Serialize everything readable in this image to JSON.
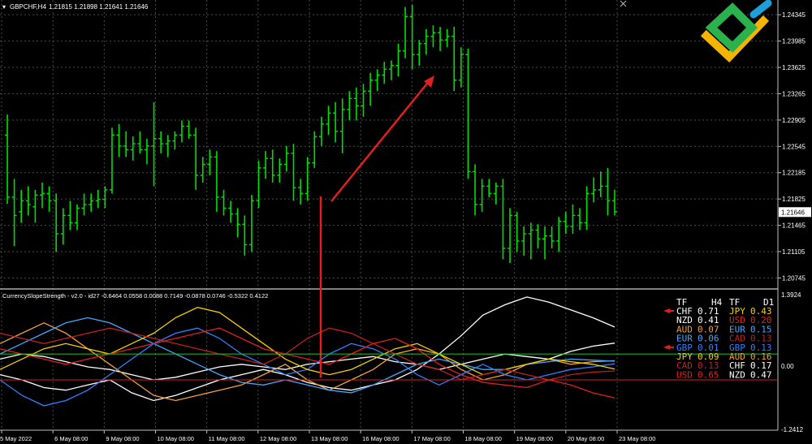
{
  "window": {
    "symbol_label": "GBPCHF,H4",
    "ohlc": "1.21815 1.21898 1.21641 1.21646",
    "close_icon": "close-x-icon"
  },
  "logo": {
    "icon": "litefinance-logo-icon",
    "colors": [
      "#2bb24c",
      "#1e9fd8",
      "#f5b400"
    ]
  },
  "colors": {
    "background": "#000000",
    "grid": "#4a4a4a",
    "candle": "#00e000",
    "arrow": "#e0201c",
    "hline_green": "#20c020",
    "hline_red": "#d02020",
    "price_tag_bg": "#ffffff"
  },
  "price_axis": {
    "ticks": [
      "1.24345",
      "1.23985",
      "1.23625",
      "1.23265",
      "1.22905",
      "1.22545",
      "1.22185",
      "1.21825",
      "1.21465",
      "1.21105",
      "1.20745"
    ],
    "current": "1.21646"
  },
  "indicator": {
    "label": "CurrencySlopeStrength - v2.0 - id27 -0.6464 0.0558 0.0088 0.7149 -0.0878 0.0746 -0.5322 0.4122",
    "axis_ticks": [
      "1.3924",
      "0.00",
      "-1.2412"
    ],
    "table": {
      "headers": [
        "TF",
        "H4",
        "TF",
        "D1"
      ],
      "rows": [
        {
          "left": "CHF",
          "lval": "0.71",
          "right": "JPY",
          "rval": "0.43",
          "lcolor": "#ffffff",
          "rcolor": "#f5d000",
          "arrow": true
        },
        {
          "left": "NZD",
          "lval": "0.41",
          "right": "USD",
          "rval": "0.20",
          "lcolor": "#ffffff",
          "rcolor": "#e02020",
          "arrow": false
        },
        {
          "left": "AUD",
          "lval": "0.07",
          "right": "EUR",
          "rval": "0.15",
          "lcolor": "#f0a040",
          "rcolor": "#40a8ff",
          "arrow": false
        },
        {
          "left": "EUR",
          "lval": "0.06",
          "right": "CAD",
          "rval": "0.13",
          "lcolor": "#40a8ff",
          "rcolor": "#c02020",
          "arrow": false
        },
        {
          "left": "GBP",
          "lval": "0.01",
          "right": "GBP",
          "rval": "0.13",
          "lcolor": "#3080ff",
          "rcolor": "#3080ff",
          "arrow": true
        },
        {
          "left": "JPY",
          "lval": "0.09",
          "right": "AUD",
          "rval": "0.16",
          "lcolor": "#f5d000",
          "rcolor": "#f0a040",
          "arrow": false
        },
        {
          "left": "CAD",
          "lval": "0.13",
          "right": "CHF",
          "rval": "0.17",
          "lcolor": "#c02020",
          "rcolor": "#ffffff",
          "arrow": false
        },
        {
          "left": "USD",
          "lval": "0.65",
          "right": "NZD",
          "rval": "0.47",
          "lcolor": "#e02020",
          "rcolor": "#ffffff",
          "arrow": false
        }
      ]
    }
  },
  "time_axis": [
    "5 May 2022",
    "6 May 08:00",
    "9 May 08:00",
    "10 May 08:00",
    "11 May 08:00",
    "12 May 08:00",
    "13 May 08:00",
    "16 May 08:00",
    "17 May 08:00",
    "18 May 08:00",
    "19 May 08:00",
    "20 May 08:00",
    "23 May 08:00"
  ],
  "chart_data": [
    {
      "type": "ohlc",
      "title": "GBPCHF,H4",
      "ylim": [
        1.2065,
        1.2448
      ],
      "bars": [
        [
          1.227,
          1.2298,
          1.2176,
          1.2185
        ],
        [
          1.2185,
          1.221,
          1.2118,
          1.216
        ],
        [
          1.2165,
          1.2195,
          1.215,
          1.218
        ],
        [
          1.218,
          1.22,
          1.216,
          1.2175
        ],
        [
          1.2172,
          1.2195,
          1.215,
          1.2188
        ],
        [
          1.2188,
          1.2205,
          1.217,
          1.219
        ],
        [
          1.219,
          1.22,
          1.2165,
          1.218
        ],
        [
          1.218,
          1.219,
          1.211,
          1.2135
        ],
        [
          1.2135,
          1.217,
          1.212,
          1.216
        ],
        [
          1.216,
          1.218,
          1.214,
          1.215
        ],
        [
          1.215,
          1.2175,
          1.214,
          1.217
        ],
        [
          1.217,
          1.219,
          1.216,
          1.2175
        ],
        [
          1.2175,
          1.219,
          1.2165,
          1.218
        ],
        [
          1.218,
          1.2195,
          1.217,
          1.2182
        ],
        [
          1.2182,
          1.22,
          1.217,
          1.2195
        ],
        [
          1.2195,
          1.228,
          1.219,
          1.227
        ],
        [
          1.227,
          1.2285,
          1.224,
          1.2255
        ],
        [
          1.2255,
          1.2275,
          1.224,
          1.225
        ],
        [
          1.225,
          1.2268,
          1.2235,
          1.2258
        ],
        [
          1.2258,
          1.2275,
          1.2245,
          1.225
        ],
        [
          1.225,
          1.2265,
          1.223,
          1.2255
        ],
        [
          1.2255,
          1.2315,
          1.22,
          1.2265
        ],
        [
          1.2265,
          1.2275,
          1.2245,
          1.2258
        ],
        [
          1.2258,
          1.227,
          1.224,
          1.2262
        ],
        [
          1.2262,
          1.2275,
          1.225,
          1.227
        ],
        [
          1.227,
          1.229,
          1.226,
          1.2282
        ],
        [
          1.2282,
          1.229,
          1.2265,
          1.227
        ],
        [
          1.227,
          1.228,
          1.2195,
          1.2215
        ],
        [
          1.2215,
          1.224,
          1.2205,
          1.223
        ],
        [
          1.223,
          1.225,
          1.2215,
          1.224
        ],
        [
          1.224,
          1.2248,
          1.2165,
          1.2185
        ],
        [
          1.2185,
          1.2195,
          1.216,
          1.217
        ],
        [
          1.217,
          1.218,
          1.215,
          1.2162
        ],
        [
          1.2162,
          1.217,
          1.213,
          1.2148
        ],
        [
          1.2148,
          1.216,
          1.2105,
          1.212
        ],
        [
          1.212,
          1.2188,
          1.211,
          1.218
        ],
        [
          1.218,
          1.2235,
          1.217,
          1.2225
        ],
        [
          1.2225,
          1.2248,
          1.221,
          1.2238
        ],
        [
          1.2238,
          1.225,
          1.2205,
          1.2215
        ],
        [
          1.2215,
          1.2238,
          1.2205,
          1.223
        ],
        [
          1.223,
          1.2255,
          1.222,
          1.2245
        ],
        [
          1.2245,
          1.2258,
          1.218,
          1.2198
        ],
        [
          1.2198,
          1.221,
          1.2175,
          1.219
        ],
        [
          1.219,
          1.224,
          1.218,
          1.2232
        ],
        [
          1.2232,
          1.2275,
          1.2225,
          1.2268
        ],
        [
          1.2268,
          1.2295,
          1.2255,
          1.2285
        ],
        [
          1.2285,
          1.231,
          1.227,
          1.23
        ],
        [
          1.23,
          1.2315,
          1.226,
          1.2275
        ],
        [
          1.2275,
          1.232,
          1.2245,
          1.2305
        ],
        [
          1.2305,
          1.233,
          1.229,
          1.232
        ],
        [
          1.232,
          1.2335,
          1.229,
          1.231
        ],
        [
          1.231,
          1.234,
          1.2295,
          1.233
        ],
        [
          1.233,
          1.2355,
          1.231,
          1.2345
        ],
        [
          1.2345,
          1.236,
          1.233,
          1.2352
        ],
        [
          1.2352,
          1.237,
          1.234,
          1.236
        ],
        [
          1.236,
          1.2372,
          1.2345,
          1.2365
        ],
        [
          1.2365,
          1.2395,
          1.235,
          1.2385
        ],
        [
          1.2385,
          1.2445,
          1.2375,
          1.2432
        ],
        [
          1.2432,
          1.2448,
          1.236,
          1.238
        ],
        [
          1.238,
          1.24,
          1.2365,
          1.2395
        ],
        [
          1.2395,
          1.2415,
          1.238,
          1.2405
        ],
        [
          1.2405,
          1.242,
          1.239,
          1.241
        ],
        [
          1.241,
          1.2418,
          1.2385,
          1.24
        ],
        [
          1.24,
          1.2415,
          1.239,
          1.2405
        ],
        [
          1.2405,
          1.2418,
          1.233,
          1.2345
        ],
        [
          1.2345,
          1.239,
          1.2335,
          1.238
        ],
        [
          1.238,
          1.2388,
          1.221,
          1.222
        ],
        [
          1.222,
          1.223,
          1.216,
          1.2175
        ],
        [
          1.2175,
          1.221,
          1.2165,
          1.22
        ],
        [
          1.22,
          1.221,
          1.2185,
          1.219
        ],
        [
          1.219,
          1.2205,
          1.2175,
          1.22
        ],
        [
          1.22,
          1.221,
          1.21,
          1.2115
        ],
        [
          1.2115,
          1.217,
          1.2095,
          1.216
        ],
        [
          1.216,
          1.2165,
          1.211,
          1.2125
        ],
        [
          1.2125,
          1.2145,
          1.2105,
          1.2135
        ],
        [
          1.2135,
          1.215,
          1.21,
          1.214
        ],
        [
          1.214,
          1.2148,
          1.2115,
          1.2128
        ],
        [
          1.2128,
          1.2145,
          1.21,
          1.2132
        ],
        [
          1.2132,
          1.2145,
          1.2115,
          1.2125
        ],
        [
          1.2125,
          1.2158,
          1.211,
          1.2152
        ],
        [
          1.2152,
          1.2165,
          1.2135,
          1.2145
        ],
        [
          1.2145,
          1.2175,
          1.2135,
          1.216
        ],
        [
          1.216,
          1.217,
          1.214,
          1.215
        ],
        [
          1.215,
          1.22,
          1.214,
          1.219
        ],
        [
          1.219,
          1.2212,
          1.2178,
          1.2195
        ],
        [
          1.2195,
          1.222,
          1.2185,
          1.22
        ],
        [
          1.22,
          1.2225,
          1.216,
          1.218
        ],
        [
          1.218,
          1.2195,
          1.216,
          1.2165
        ]
      ],
      "annotations": [
        "arrow-up-right"
      ]
    },
    {
      "type": "line",
      "title": "CurrencySlopeStrength - v2.0",
      "ylim": [
        -1.2412,
        1.3924
      ],
      "hlines": [
        0.2,
        0.0
      ],
      "series": [
        {
          "name": "CHF",
          "color": "#ffffff",
          "values": [
            -0.2,
            -0.3,
            -0.45,
            -0.5,
            -0.4,
            -0.3,
            -0.55,
            -0.7,
            -0.6,
            -0.45,
            -0.3,
            -0.2,
            -0.1,
            -0.2,
            -0.35,
            -0.45,
            -0.5,
            -0.4,
            -0.3,
            -0.1,
            0.2,
            0.55,
            0.95,
            1.15,
            1.3,
            1.2,
            1.05,
            0.9,
            0.72
          ]
        },
        {
          "name": "NZD",
          "color": "#ffffff",
          "values": [
            0.1,
            0.2,
            0.15,
            0.05,
            -0.05,
            -0.1,
            -0.2,
            -0.3,
            -0.25,
            -0.15,
            -0.05,
            0.0,
            -0.05,
            -0.1,
            0.0,
            0.05,
            0.1,
            0.15,
            0.05,
            0.0,
            -0.1,
            0.0,
            0.1,
            0.2,
            0.15,
            0.1,
            0.25,
            0.35,
            0.41
          ]
        },
        {
          "name": "AUD",
          "color": "#f0a040",
          "values": [
            0.4,
            0.6,
            0.8,
            0.6,
            0.3,
            0.0,
            -0.3,
            -0.6,
            -0.7,
            -0.6,
            -0.5,
            -0.4,
            -0.2,
            0.0,
            -0.3,
            -0.5,
            -0.3,
            -0.1,
            0.2,
            0.3,
            0.2,
            -0.1,
            -0.3,
            -0.2,
            0.0,
            0.1,
            0.0,
            0.05,
            0.07
          ]
        },
        {
          "name": "EUR",
          "color": "#40a8ff",
          "values": [
            0.2,
            0.4,
            0.6,
            0.8,
            0.9,
            0.8,
            0.6,
            0.4,
            0.2,
            0.0,
            -0.2,
            -0.35,
            -0.4,
            -0.3,
            -0.4,
            -0.5,
            -0.55,
            -0.4,
            -0.2,
            0.0,
            0.1,
            0.0,
            -0.1,
            -0.1,
            0.0,
            0.05,
            0.1,
            0.08,
            0.06
          ]
        },
        {
          "name": "GBP",
          "color": "#3080ff",
          "values": [
            -0.3,
            -0.6,
            -0.8,
            -0.7,
            -0.5,
            -0.2,
            0.1,
            0.4,
            0.6,
            0.7,
            0.5,
            0.2,
            0.0,
            -0.2,
            -0.1,
            0.2,
            0.4,
            0.3,
            0.1,
            -0.2,
            -0.4,
            -0.2,
            0.0,
            -0.2,
            -0.3,
            -0.2,
            -0.1,
            -0.05,
            0.01
          ]
        },
        {
          "name": "JPY",
          "color": "#f5d000",
          "values": [
            -0.1,
            0.1,
            0.3,
            0.4,
            0.3,
            0.2,
            0.4,
            0.6,
            0.9,
            1.1,
            1.0,
            0.7,
            0.4,
            0.1,
            -0.1,
            -0.2,
            -0.1,
            0.1,
            0.3,
            0.4,
            0.2,
            0.0,
            -0.2,
            -0.1,
            0.0,
            0.1,
            0.05,
            0.0,
            -0.09
          ]
        },
        {
          "name": "CAD",
          "color": "#c02020",
          "values": [
            0.6,
            0.5,
            0.4,
            0.5,
            0.6,
            0.7,
            0.6,
            0.5,
            0.4,
            0.3,
            0.2,
            0.1,
            0.0,
            0.2,
            0.5,
            0.7,
            0.6,
            0.4,
            0.2,
            0.0,
            -0.1,
            -0.3,
            -0.2,
            -0.1,
            -0.2,
            -0.3,
            -0.2,
            -0.15,
            -0.13
          ]
        },
        {
          "name": "USD",
          "color": "#e02020",
          "values": [
            0.3,
            0.2,
            0.1,
            0.0,
            0.1,
            0.2,
            0.3,
            0.4,
            0.5,
            0.6,
            0.7,
            0.5,
            0.3,
            0.2,
            0.1,
            0.0,
            0.2,
            0.4,
            0.5,
            0.3,
            0.0,
            -0.2,
            -0.35,
            -0.4,
            -0.45,
            -0.3,
            -0.4,
            -0.55,
            -0.65
          ]
        }
      ]
    }
  ]
}
